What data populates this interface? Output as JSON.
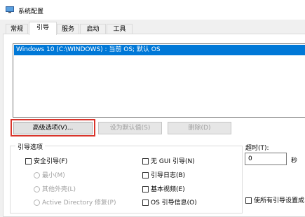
{
  "window": {
    "title": "系统配置",
    "icon": "msconfig-icon"
  },
  "tabs": [
    {
      "label": "常规"
    },
    {
      "label": "引导"
    },
    {
      "label": "服务"
    },
    {
      "label": "启动"
    },
    {
      "label": "工具"
    }
  ],
  "active_tab": "引导",
  "os_list": {
    "entries": [
      "Windows 10 (C:\\WINDOWS) : 当前 OS; 默认 OS"
    ]
  },
  "buttons": {
    "advanced": "高级选项(V)...",
    "set_default": "设为默认值(S)",
    "delete": "删除(D)"
  },
  "boot_options": {
    "group_label": "引导选项",
    "safe_boot": "安全引导(F)",
    "minimal": "最小(M)",
    "alternate_shell": "其他外壳(L)",
    "active_directory": "Active Directory 修复(P)",
    "no_gui_boot": "无 GUI 引导(N)",
    "boot_log": "引导日志(B)",
    "base_video": "基本视频(E)",
    "os_boot_info": "OS 引导信息(O)"
  },
  "timeout": {
    "label": "超时(T):",
    "value": "0",
    "unit": "秒"
  },
  "make_permanent": "使所有引导设置成",
  "colors": {
    "selection": "#0078d7",
    "focus_ring": "#d9342b"
  }
}
